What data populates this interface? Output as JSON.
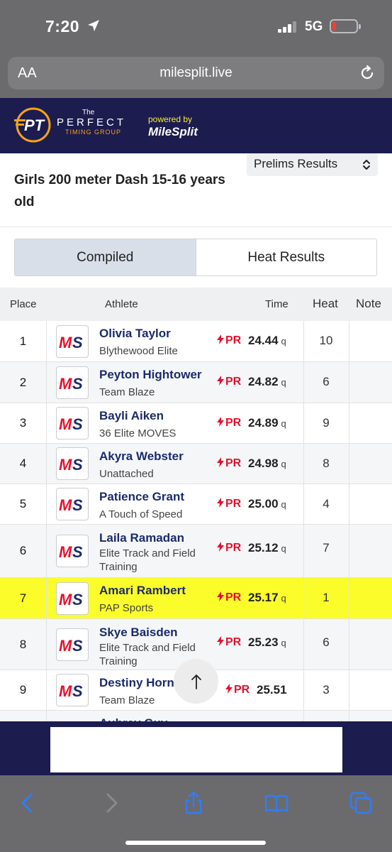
{
  "status": {
    "time": "7:20",
    "network": "5G"
  },
  "browser": {
    "text_size_label": "AA",
    "url": "milesplit.live"
  },
  "brand": {
    "the": "The",
    "perfect": "PERFECT",
    "timing": "TIMING GROUP",
    "powered_by": "powered by",
    "milesplit": "MileSplit"
  },
  "event": {
    "title": "Girls 200 meter Dash 15-16 years old",
    "round_selected": "Prelims Results"
  },
  "tabs": [
    {
      "label": "Compiled"
    },
    {
      "label": "Heat Results"
    }
  ],
  "columns": {
    "place": "Place",
    "athlete": "Athlete",
    "time": "Time",
    "heat": "Heat",
    "note": "Note"
  },
  "pr_label": "PR",
  "results": [
    {
      "place": "1",
      "name": "Olivia Taylor",
      "team": "Blythewood Elite",
      "time": "24.44",
      "q": "q",
      "heat": "10"
    },
    {
      "place": "2",
      "name": "Peyton Hightower",
      "team": "Team Blaze",
      "time": "24.82",
      "q": "q",
      "heat": "6"
    },
    {
      "place": "3",
      "name": "Bayli Aiken",
      "team": "36 Elite MOVES",
      "time": "24.89",
      "q": "q",
      "heat": "9"
    },
    {
      "place": "4",
      "name": "Akyra Webster",
      "team": "Unattached",
      "time": "24.98",
      "q": "q",
      "heat": "8"
    },
    {
      "place": "5",
      "name": "Patience Grant",
      "team": "A Touch of Speed",
      "time": "25.00",
      "q": "q",
      "heat": "4"
    },
    {
      "place": "6",
      "name": "Laila Ramadan",
      "team": "Elite Track and Field Training",
      "time": "25.12",
      "q": "q",
      "heat": "7"
    },
    {
      "place": "7",
      "name": "Amari Rambert",
      "team": "PAP Sports",
      "time": "25.17",
      "q": "q",
      "heat": "1"
    },
    {
      "place": "8",
      "name": "Skye Baisden",
      "team": "Elite Track and Field Training",
      "time": "25.23",
      "q": "q",
      "heat": "6"
    },
    {
      "place": "9",
      "name": "Destiny Horn",
      "team": "Team Blaze",
      "time": "25.51",
      "q": "",
      "heat": "3"
    },
    {
      "place": "",
      "name": "Aubrey Guy",
      "team": "",
      "time": "",
      "q": "",
      "heat": ""
    }
  ],
  "colors": {
    "brand_navy": "#1c1c4f",
    "pr_red": "#e8102d",
    "highlight": "#fbfd2b",
    "name_blue": "#1c2b6a"
  }
}
